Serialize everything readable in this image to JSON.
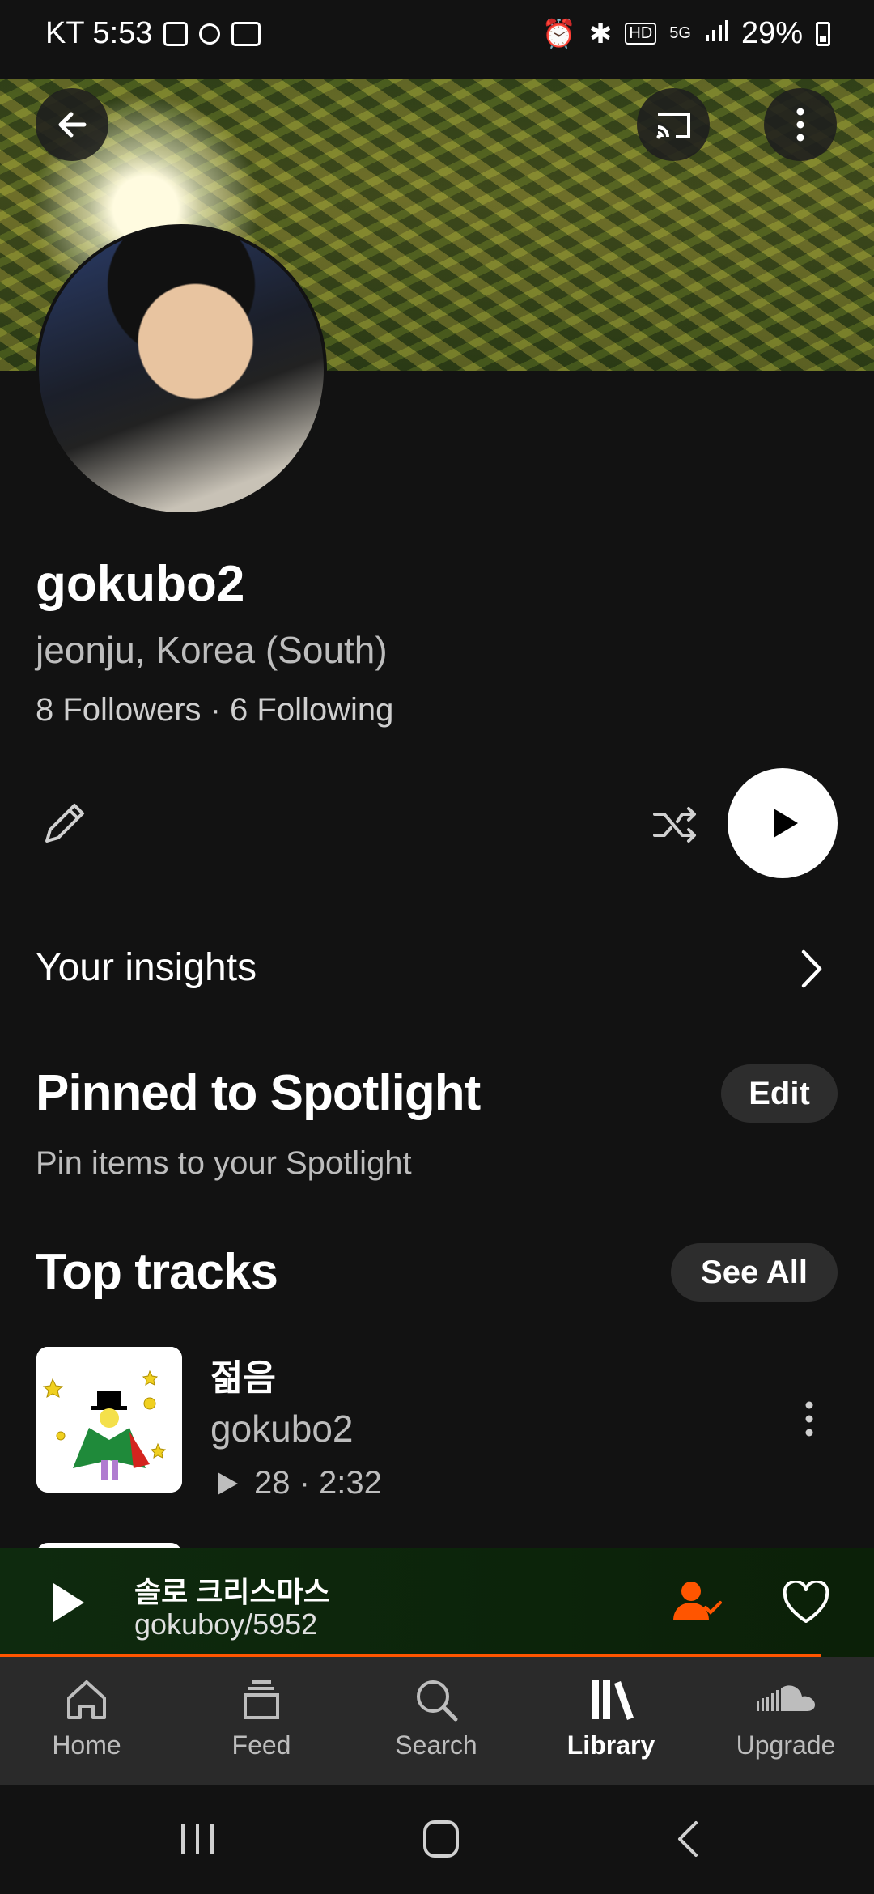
{
  "status_bar": {
    "carrier_time": "KT 5:53",
    "battery": "29%"
  },
  "profile": {
    "username": "gokubo2",
    "location": "jeonju, Korea (South)",
    "follow_stats": "8 Followers · 6 Following"
  },
  "insights": {
    "label": "Your insights"
  },
  "spotlight": {
    "title": "Pinned to Spotlight",
    "edit_label": "Edit",
    "subtitle": "Pin items to your Spotlight"
  },
  "top_tracks": {
    "title": "Top tracks",
    "see_all_label": "See All",
    "tracks": [
      {
        "title": "젊음",
        "artist": "gokubo2",
        "stats": "28 · 2:32"
      }
    ]
  },
  "mini_player": {
    "title": "솔로 크리스마스",
    "artist": "gokuboy/5952",
    "accent": "#ff5500",
    "progress": 0.94
  },
  "bottom_nav": {
    "items": [
      {
        "label": "Home",
        "icon": "home-icon"
      },
      {
        "label": "Feed",
        "icon": "feed-icon"
      },
      {
        "label": "Search",
        "icon": "search-icon"
      },
      {
        "label": "Library",
        "icon": "library-icon",
        "active": true
      },
      {
        "label": "Upgrade",
        "icon": "soundcloud-icon"
      }
    ]
  }
}
